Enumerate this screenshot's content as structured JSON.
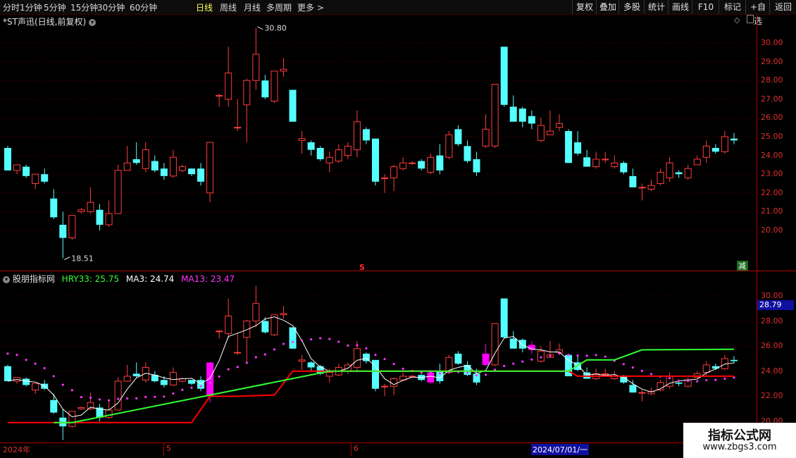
{
  "toolbar": {
    "tabs": [
      "分时",
      "1分钟",
      "5分钟",
      "15分钟",
      "30分钟",
      "60分钟",
      "日线",
      "周线",
      "月线",
      "多周期",
      "更多 >"
    ],
    "active": "日线",
    "right_buttons": [
      "复权",
      "叠加",
      "多股",
      "统计",
      "画线",
      "F10",
      "标记",
      "+自选",
      "返回"
    ]
  },
  "main_panel": {
    "title": "*ST声迅(日线,前复权)",
    "price_ticks": [
      "30.00",
      "29.00",
      "28.00",
      "27.00",
      "26.00",
      "25.00",
      "24.00",
      "23.00",
      "22.00",
      "21.00",
      "20.00"
    ],
    "high_label": "30.80",
    "low_label": "18.51",
    "marker_s": "S",
    "marker_reduce": "减"
  },
  "indicator_panel": {
    "name": "股朋指标网",
    "legend": [
      {
        "label": "HRY33: 25.75",
        "color": "#33ff33"
      },
      {
        "label": "MA3: 24.74",
        "color": "#ffffff"
      },
      {
        "label": "MA13: 23.47",
        "color": "#ff33ff"
      }
    ],
    "ticks": [
      "30.00",
      "28.00",
      "26.00",
      "24.00",
      "22.00",
      "20.00"
    ],
    "current_value": "28.79"
  },
  "date_axis": {
    "labels": [
      "2024年",
      "5",
      "6",
      "2024/07/01/一"
    ]
  },
  "watermark": {
    "line1": "指标公式网",
    "line2": "www.zbgs3.com"
  },
  "colors": {
    "up": "#ff3c3c",
    "down": "#54ffff",
    "hry": "#33ff33",
    "ma3": "#ffffff",
    "ma13": "#ff33ff",
    "signal": "#ff00ff",
    "base": "#ff0000"
  },
  "chart_data": {
    "type": "candlestick",
    "ohlc": [
      {
        "o": 24.4,
        "h": 24.5,
        "l": 23.2,
        "c": 23.2
      },
      {
        "o": 23.2,
        "h": 23.5,
        "l": 23.0,
        "c": 23.5
      },
      {
        "o": 23.4,
        "h": 23.5,
        "l": 22.8,
        "c": 22.9
      },
      {
        "o": 22.5,
        "h": 23.0,
        "l": 22.2,
        "c": 23.0
      },
      {
        "o": 23.0,
        "h": 23.3,
        "l": 22.5,
        "c": 22.6
      },
      {
        "o": 21.7,
        "h": 22.2,
        "l": 20.6,
        "c": 20.7
      },
      {
        "o": 20.3,
        "h": 21.0,
        "l": 18.51,
        "c": 19.6
      },
      {
        "o": 19.6,
        "h": 20.8,
        "l": 19.5,
        "c": 20.8
      },
      {
        "o": 21.0,
        "h": 21.2,
        "l": 20.9,
        "c": 21.1
      },
      {
        "o": 21.0,
        "h": 22.3,
        "l": 20.9,
        "c": 21.5
      },
      {
        "o": 21.1,
        "h": 21.4,
        "l": 20.0,
        "c": 20.3
      },
      {
        "o": 20.3,
        "h": 21.6,
        "l": 20.2,
        "c": 20.9
      },
      {
        "o": 20.9,
        "h": 23.5,
        "l": 20.9,
        "c": 23.2
      },
      {
        "o": 23.2,
        "h": 24.5,
        "l": 23.2,
        "c": 23.6
      },
      {
        "o": 23.8,
        "h": 24.7,
        "l": 23.5,
        "c": 23.6
      },
      {
        "o": 23.3,
        "h": 24.7,
        "l": 23.1,
        "c": 24.3
      },
      {
        "o": 23.7,
        "h": 24.0,
        "l": 23.1,
        "c": 23.2
      },
      {
        "o": 23.3,
        "h": 23.6,
        "l": 22.7,
        "c": 22.9
      },
      {
        "o": 22.9,
        "h": 24.3,
        "l": 22.8,
        "c": 23.9
      },
      {
        "o": 23.2,
        "h": 23.5,
        "l": 23.1,
        "c": 23.4
      },
      {
        "o": 23.3,
        "h": 23.3,
        "l": 22.9,
        "c": 23.0
      },
      {
        "o": 23.3,
        "h": 23.6,
        "l": 22.4,
        "c": 22.6
      },
      {
        "o": 22.0,
        "h": 24.7,
        "l": 21.5,
        "c": 24.7
      },
      {
        "o": 27.2,
        "h": 27.3,
        "l": 26.6,
        "c": 27.2
      },
      {
        "o": 27.0,
        "h": 29.8,
        "l": 26.6,
        "c": 28.4
      },
      {
        "o": 25.5,
        "h": 27.0,
        "l": 25.3,
        "c": 25.5
      },
      {
        "o": 26.7,
        "h": 28.1,
        "l": 24.7,
        "c": 28.0
      },
      {
        "o": 28.0,
        "h": 30.8,
        "l": 27.5,
        "c": 29.4
      },
      {
        "o": 28.0,
        "h": 28.3,
        "l": 27.0,
        "c": 27.1
      },
      {
        "o": 26.9,
        "h": 28.5,
        "l": 26.8,
        "c": 28.5
      },
      {
        "o": 28.5,
        "h": 29.2,
        "l": 28.2,
        "c": 28.6
      },
      {
        "o": 27.5,
        "h": 27.5,
        "l": 25.8,
        "c": 25.8
      },
      {
        "o": 24.8,
        "h": 25.3,
        "l": 24.1,
        "c": 24.9
      },
      {
        "o": 24.7,
        "h": 24.8,
        "l": 24.0,
        "c": 24.3
      },
      {
        "o": 24.4,
        "h": 24.5,
        "l": 23.7,
        "c": 23.8
      },
      {
        "o": 23.6,
        "h": 24.2,
        "l": 23.1,
        "c": 23.9
      },
      {
        "o": 23.7,
        "h": 24.6,
        "l": 23.6,
        "c": 24.3
      },
      {
        "o": 24.0,
        "h": 24.7,
        "l": 23.8,
        "c": 24.5
      },
      {
        "o": 24.3,
        "h": 26.4,
        "l": 23.9,
        "c": 25.8
      },
      {
        "o": 25.4,
        "h": 25.5,
        "l": 24.6,
        "c": 24.8
      },
      {
        "o": 24.9,
        "h": 24.9,
        "l": 22.4,
        "c": 22.6
      },
      {
        "o": 22.8,
        "h": 23.0,
        "l": 22.0,
        "c": 22.8
      },
      {
        "o": 22.8,
        "h": 23.5,
        "l": 22.1,
        "c": 23.4
      },
      {
        "o": 23.3,
        "h": 23.9,
        "l": 23.2,
        "c": 23.6
      },
      {
        "o": 23.6,
        "h": 23.7,
        "l": 23.5,
        "c": 23.6
      },
      {
        "o": 23.7,
        "h": 23.8,
        "l": 23.2,
        "c": 23.3
      },
      {
        "o": 23.1,
        "h": 24.1,
        "l": 23.0,
        "c": 23.9
      },
      {
        "o": 24.0,
        "h": 24.6,
        "l": 23.0,
        "c": 23.2
      },
      {
        "o": 23.9,
        "h": 25.3,
        "l": 23.8,
        "c": 25.1
      },
      {
        "o": 25.4,
        "h": 25.6,
        "l": 24.5,
        "c": 24.6
      },
      {
        "o": 24.5,
        "h": 24.8,
        "l": 23.6,
        "c": 23.7
      },
      {
        "o": 23.8,
        "h": 24.2,
        "l": 22.9,
        "c": 23.1
      },
      {
        "o": 24.5,
        "h": 26.2,
        "l": 24.4,
        "c": 25.4
      },
      {
        "o": 24.5,
        "h": 27.8,
        "l": 24.4,
        "c": 27.8
      },
      {
        "o": 29.8,
        "h": 29.8,
        "l": 26.6,
        "c": 26.7
      },
      {
        "o": 26.6,
        "h": 27.2,
        "l": 25.8,
        "c": 25.8
      },
      {
        "o": 26.5,
        "h": 26.6,
        "l": 25.5,
        "c": 25.8
      },
      {
        "o": 26.1,
        "h": 26.4,
        "l": 25.4,
        "c": 25.7
      },
      {
        "o": 24.8,
        "h": 26.0,
        "l": 24.7,
        "c": 25.6
      },
      {
        "o": 25.1,
        "h": 26.4,
        "l": 25.1,
        "c": 25.3
      },
      {
        "o": 25.5,
        "h": 26.2,
        "l": 25.3,
        "c": 25.7
      },
      {
        "o": 25.3,
        "h": 25.4,
        "l": 23.6,
        "c": 23.6
      },
      {
        "o": 24.7,
        "h": 25.3,
        "l": 24.0,
        "c": 24.1
      },
      {
        "o": 23.9,
        "h": 24.3,
        "l": 23.4,
        "c": 23.4
      },
      {
        "o": 23.4,
        "h": 24.2,
        "l": 23.3,
        "c": 23.8
      },
      {
        "o": 23.8,
        "h": 24.2,
        "l": 23.6,
        "c": 23.8
      },
      {
        "o": 23.4,
        "h": 24.0,
        "l": 23.3,
        "c": 23.6
      },
      {
        "o": 23.6,
        "h": 23.7,
        "l": 23.0,
        "c": 23.1
      },
      {
        "o": 22.9,
        "h": 23.3,
        "l": 22.9,
        "c": 22.3
      },
      {
        "o": 22.3,
        "h": 22.5,
        "l": 21.6,
        "c": 22.3
      },
      {
        "o": 22.2,
        "h": 22.7,
        "l": 22.1,
        "c": 22.4
      },
      {
        "o": 22.5,
        "h": 23.3,
        "l": 22.4,
        "c": 23.1
      },
      {
        "o": 22.8,
        "h": 23.9,
        "l": 22.6,
        "c": 23.6
      },
      {
        "o": 23.1,
        "h": 23.2,
        "l": 22.8,
        "c": 23.0
      },
      {
        "o": 22.8,
        "h": 23.5,
        "l": 22.7,
        "c": 23.3
      },
      {
        "o": 23.5,
        "h": 24.0,
        "l": 23.5,
        "c": 23.8
      },
      {
        "o": 23.9,
        "h": 24.8,
        "l": 23.6,
        "c": 24.5
      },
      {
        "o": 24.4,
        "h": 24.6,
        "l": 24.1,
        "c": 24.2
      },
      {
        "o": 24.2,
        "h": 25.3,
        "l": 24.1,
        "c": 25.0
      },
      {
        "o": 24.9,
        "h": 25.2,
        "l": 24.6,
        "c": 24.8
      }
    ],
    "signal_bars": [
      22,
      46,
      52,
      57
    ]
  }
}
